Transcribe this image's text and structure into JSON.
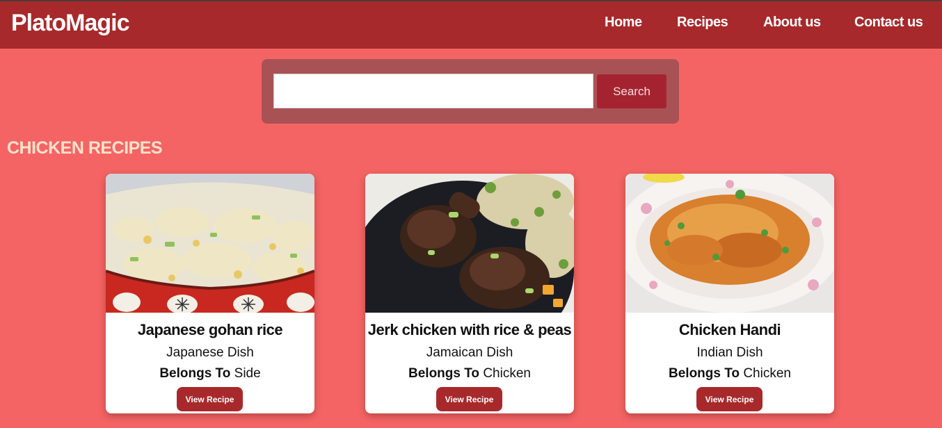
{
  "navbar": {
    "brand": "PlatoMagic",
    "links": [
      "Home",
      "Recipes",
      "About us",
      "Contact us"
    ]
  },
  "search": {
    "value": "",
    "placeholder": "",
    "button_label": "Search"
  },
  "section_title": "CHICKEN RECIPES",
  "cards": [
    {
      "title": "Japanese gohan rice",
      "cuisine": "Japanese Dish",
      "belongs_label": "Belongs To",
      "category": "Side",
      "button_label": "View Recipe",
      "image": "fried-rice-bowl-photo"
    },
    {
      "title": "Jerk chicken with rice & peas",
      "cuisine": "Jamaican Dish",
      "belongs_label": "Belongs To",
      "category": "Chicken",
      "button_label": "View Recipe",
      "image": "jerk-chicken-plate-photo"
    },
    {
      "title": "Chicken Handi",
      "cuisine": "Indian Dish",
      "belongs_label": "Belongs To",
      "category": "Chicken",
      "button_label": "View Recipe",
      "image": "chicken-handi-plate-photo"
    }
  ],
  "colors": {
    "page_background": "#f46464",
    "navbar": "#a8292b",
    "search_button": "#a52331",
    "section_title": "#ffe3cb"
  }
}
